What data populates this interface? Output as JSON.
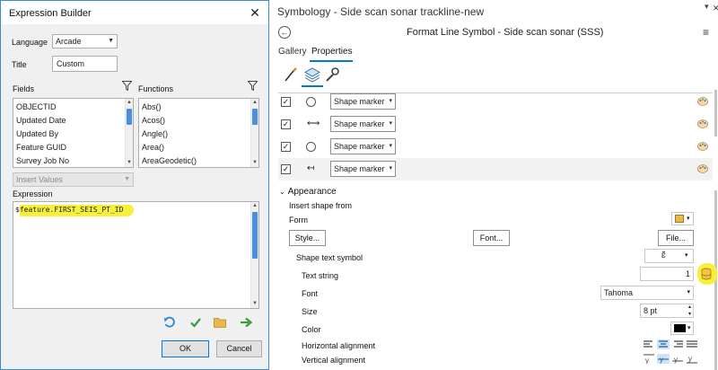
{
  "expression_builder": {
    "title": "Expression Builder",
    "close_glyph": "✕",
    "language_label": "Language",
    "language_value": "Arcade",
    "title_label": "Title",
    "title_value": "Custom",
    "fields_label": "Fields",
    "functions_label": "Functions",
    "fields": [
      "OBJECTID",
      "Updated Date",
      "Updated By",
      "Feature GUID",
      "Survey Job No"
    ],
    "functions": [
      "Abs()",
      "Acos()",
      "Angle()",
      "Area()",
      "AreaGeodetic()"
    ],
    "insert_values_label": "Insert Values",
    "expression_label": "Expression",
    "expression_prefix": "$",
    "expression_highlight": "feature.FIRST_SEIS_PT_ID",
    "ok_label": "OK",
    "cancel_label": "Cancel",
    "icons": [
      "undo-icon",
      "verify-checkmark-icon",
      "open-folder-icon",
      "export-arrow-icon"
    ]
  },
  "symbology": {
    "title": "Symbology - Side scan sonar trackline-new",
    "pin_glyph": "▾",
    "close_glyph": "✕",
    "back_glyph": "←",
    "format_title": "Format Line Symbol - Side scan sonar (SSS)",
    "menu_glyph": "≡",
    "tabs": [
      {
        "label": "Gallery"
      },
      {
        "label": "Properties"
      }
    ],
    "tools": [
      "brush-icon",
      "layers-icon",
      "wrench-icon"
    ],
    "layers": [
      {
        "checked": true,
        "marker": "circle",
        "type": "Shape marker"
      },
      {
        "checked": true,
        "marker": "arrow",
        "type": "Shape marker"
      },
      {
        "checked": true,
        "marker": "circle",
        "type": "Shape marker"
      },
      {
        "checked": true,
        "marker": "arrow-left",
        "type": "Shape marker"
      }
    ],
    "check_glyph": "✓",
    "appearance": {
      "section_label": "Appearance",
      "insert_shape_from": "Insert shape from",
      "form_label": "Form",
      "style_button": "Style...",
      "font_button": "Font...",
      "file_button": "File...",
      "shape_text_symbol_label": "Shape text symbol",
      "text_string_label": "Text string",
      "text_string_value": "1",
      "font_label": "Font",
      "font_value": "Tahoma",
      "size_label": "Size",
      "size_value": "8 pt",
      "color_label": "Color",
      "color_value": "#000000",
      "horizontal_alignment_label": "Horizontal alignment",
      "vertical_alignment_label": "Vertical alignment",
      "section_chevron": "⌄"
    },
    "colors": {
      "accent": "#0078d7",
      "highlight": "#f7f03b",
      "scroll_thumb": "#4a90e2"
    }
  }
}
